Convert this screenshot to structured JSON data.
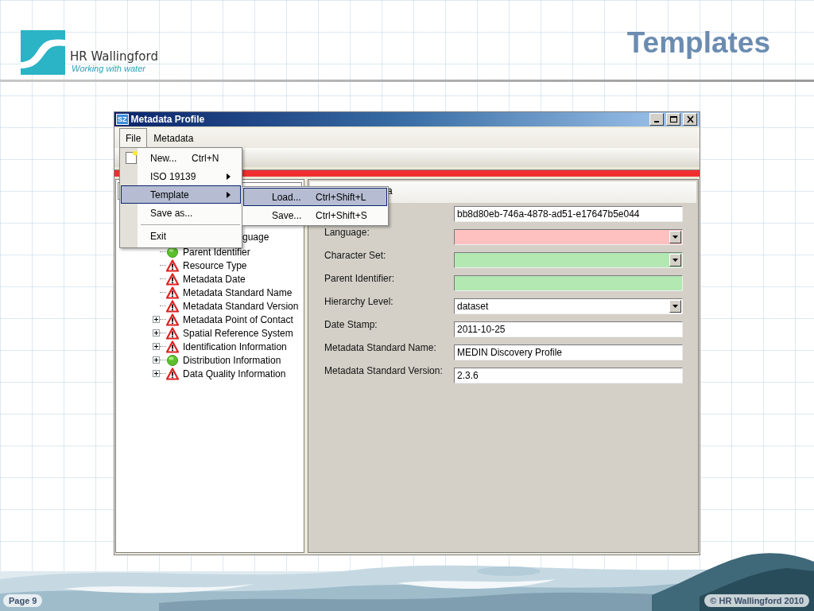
{
  "logo": {
    "name": "HR Wallingford",
    "tagline": "Working with water"
  },
  "slide_title": "Templates",
  "window": {
    "app_icon_text": "SZ",
    "title": "Metadata Profile"
  },
  "menu_bar": [
    {
      "label": "File",
      "selected": true
    },
    {
      "label": "Metadata",
      "selected": false
    }
  ],
  "file_menu": [
    {
      "kind": "icon-item",
      "label": "New...",
      "shortcut": "Ctrl+N",
      "selected": false
    },
    {
      "kind": "submenu",
      "label": "ISO 19139",
      "selected": false
    },
    {
      "kind": "submenu",
      "label": "Template",
      "selected": true
    },
    {
      "kind": "item",
      "label": "Save as...",
      "selected": false
    },
    {
      "kind": "separator"
    },
    {
      "kind": "item",
      "label": "Exit",
      "selected": false
    }
  ],
  "template_submenu": [
    {
      "label": "Load...",
      "shortcut": "Ctrl+Shift+L",
      "selected": true
    },
    {
      "label": "Save...",
      "shortcut": "Ctrl+Shift+S",
      "selected": false
    }
  ],
  "tree": {
    "items": [
      {
        "label": "guage",
        "kind": "cut"
      },
      {
        "label": "Parent Identifier",
        "kind": "ok"
      },
      {
        "label": "Resource Type",
        "kind": "warning"
      },
      {
        "label": "Metadata Date",
        "kind": "warning"
      },
      {
        "label": "Metadata Standard Name",
        "kind": "warning"
      },
      {
        "label": "Metadata Standard Version",
        "kind": "warning"
      },
      {
        "label": "Metadata Point of Contact",
        "kind": "warning",
        "expanded": false
      },
      {
        "label": "Spatial Reference System",
        "kind": "warning",
        "expanded": false
      },
      {
        "label": "Identification Information",
        "kind": "warning",
        "expanded": false
      },
      {
        "label": "Distribution Information",
        "kind": "ok",
        "expanded": false
      },
      {
        "label": "Data Quality Information",
        "kind": "warning",
        "expanded": false
      }
    ]
  },
  "detail_header": "a",
  "form": [
    {
      "kind": "text",
      "value": "bb8d80eb-746a-4878-ad51-e17647b5e044",
      "color": "#ffffff"
    },
    {
      "label": "Language:",
      "kind": "combo",
      "color": "#ffc0c0"
    },
    {
      "label": "Character Set:",
      "kind": "combo",
      "color": "#b3e8b3"
    },
    {
      "label": "Parent Identifier:",
      "kind": "text",
      "color": "#b3e8b3"
    },
    {
      "label": "Hierarchy Level:",
      "kind": "combo",
      "value": "dataset",
      "color": "#ffffff"
    },
    {
      "label": "Date Stamp:",
      "kind": "text",
      "value": "2011-10-25",
      "color": "#ffffff"
    },
    {
      "label": "Metadata Standard Name:",
      "kind": "text",
      "value": "MEDIN Discovery Profile",
      "color": "#ffffff"
    },
    {
      "label": "Metadata Standard Version:",
      "kind": "text",
      "value": "2.3.6",
      "color": "#ffffff"
    }
  ],
  "footer": {
    "page": "Page 9",
    "copyright": "© HR Wallingford 2010"
  }
}
